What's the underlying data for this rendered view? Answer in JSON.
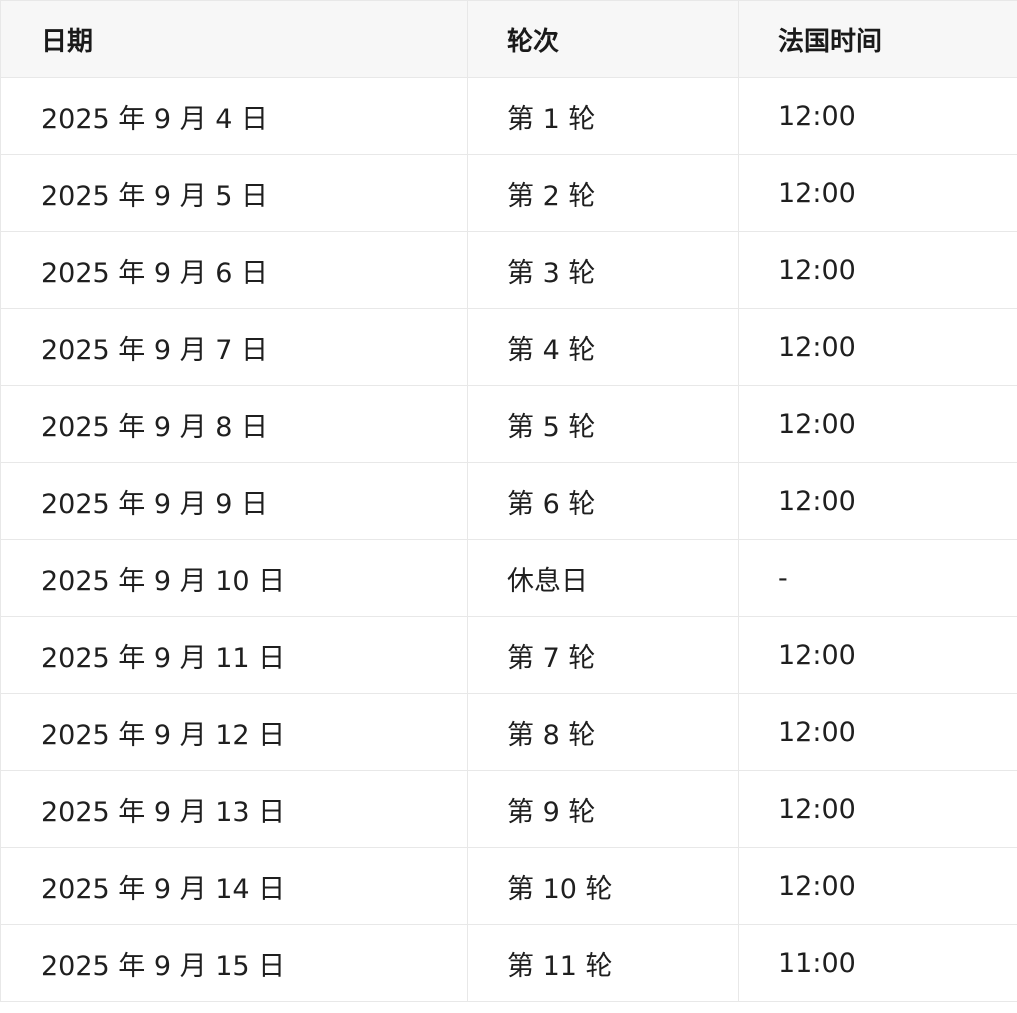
{
  "table": {
    "headers": {
      "date": "日期",
      "round": "轮次",
      "time": "法国时间"
    },
    "rows": [
      {
        "date": "2025 年 9 月 4 日",
        "round": "第 1 轮",
        "time": "12:00"
      },
      {
        "date": "2025 年 9 月 5 日",
        "round": "第 2 轮",
        "time": "12:00"
      },
      {
        "date": "2025 年 9 月 6 日",
        "round": "第 3 轮",
        "time": "12:00"
      },
      {
        "date": "2025 年 9 月 7 日",
        "round": "第 4 轮",
        "time": "12:00"
      },
      {
        "date": "2025 年 9 月 8 日",
        "round": "第 5 轮",
        "time": "12:00"
      },
      {
        "date": "2025 年 9 月 9 日",
        "round": "第 6 轮",
        "time": "12:00"
      },
      {
        "date": "2025 年 9 月 10 日",
        "round": "休息日",
        "time": "-"
      },
      {
        "date": "2025 年 9 月 11 日",
        "round": "第 7 轮",
        "time": "12:00"
      },
      {
        "date": "2025 年 9 月 12 日",
        "round": "第 8 轮",
        "time": "12:00"
      },
      {
        "date": "2025 年 9 月 13 日",
        "round": "第 9 轮",
        "time": "12:00"
      },
      {
        "date": "2025 年 9 月 14 日",
        "round": "第 10 轮",
        "time": "12:00"
      },
      {
        "date": "2025 年 9 月 15 日",
        "round": "第 11 轮",
        "time": "11:00"
      }
    ]
  }
}
